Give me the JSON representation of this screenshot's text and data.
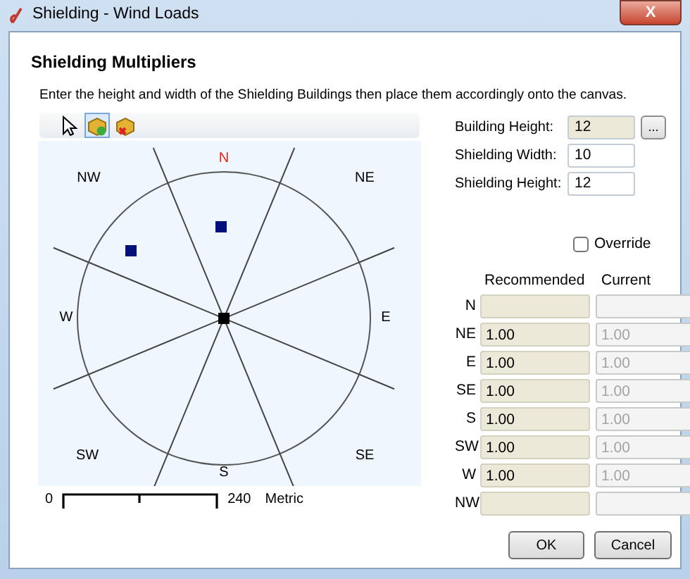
{
  "window": {
    "title": "Shielding - Wind Loads",
    "close_label": "X"
  },
  "heading": "Shielding Multipliers",
  "instruction": "Enter the height and width of the Shielding Buildings then place them accordingly onto the canvas.",
  "tools": [
    {
      "kind": "pointer",
      "selected": false
    },
    {
      "kind": "add",
      "selected": true
    },
    {
      "kind": "remove",
      "selected": false
    }
  ],
  "compass": {
    "labels": [
      {
        "text": "N",
        "highlighted": true
      },
      {
        "text": "NE",
        "highlighted": false
      },
      {
        "text": "E",
        "highlighted": false
      },
      {
        "text": "SE",
        "highlighted": false
      },
      {
        "text": "S",
        "highlighted": false
      },
      {
        "text": "SW",
        "highlighted": false
      },
      {
        "text": "W",
        "highlighted": false
      },
      {
        "text": "NW",
        "highlighted": false
      }
    ]
  },
  "scale": {
    "start": "0",
    "end": "240",
    "unit": "Metric"
  },
  "fields": [
    {
      "label": "Building Height:",
      "value": "12",
      "readonly": true,
      "browse": "..."
    },
    {
      "label": "Shielding Width:",
      "value": "10",
      "readonly": false
    },
    {
      "label": "Shielding Height:",
      "value": "12",
      "readonly": false
    }
  ],
  "override": {
    "label": "Override",
    "checked": false
  },
  "columns": [
    "Recommended",
    "Current"
  ],
  "rows": [
    {
      "direction": "N",
      "recommended": "",
      "current": ""
    },
    {
      "direction": "NE",
      "recommended": "1.00",
      "current": "1.00"
    },
    {
      "direction": "E",
      "recommended": "1.00",
      "current": "1.00"
    },
    {
      "direction": "SE",
      "recommended": "1.00",
      "current": "1.00"
    },
    {
      "direction": "S",
      "recommended": "1.00",
      "current": "1.00"
    },
    {
      "direction": "SW",
      "recommended": "1.00",
      "current": "1.00"
    },
    {
      "direction": "W",
      "recommended": "1.00",
      "current": "1.00"
    },
    {
      "direction": "NW",
      "recommended": "",
      "current": ""
    }
  ],
  "buttons": [
    "OK",
    "Cancel"
  ]
}
